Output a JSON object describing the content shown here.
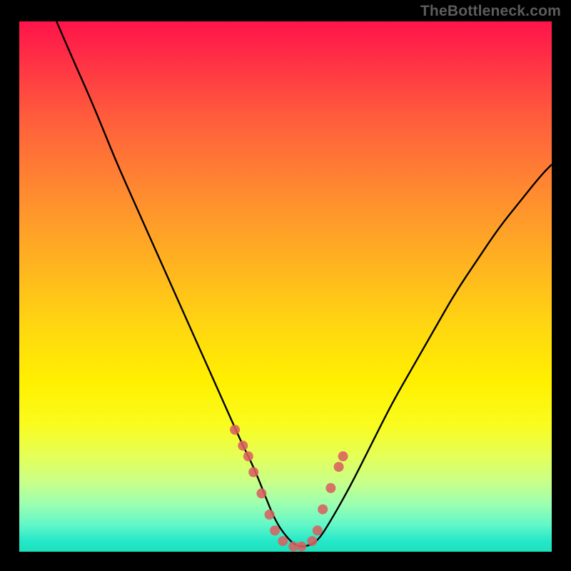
{
  "watermark": "TheBottleneck.com",
  "colors": {
    "frame_bg": "#000000",
    "curve_stroke": "#000000",
    "dot_fill": "#d9605f",
    "gradient_top": "#ff144a",
    "gradient_bottom": "#1ee0bc"
  },
  "chart_data": {
    "type": "line",
    "title": "",
    "xlabel": "",
    "ylabel": "",
    "xlim": [
      0,
      100
    ],
    "ylim": [
      0,
      100
    ],
    "grid": false,
    "series": [
      {
        "name": "curve",
        "x": [
          7,
          10,
          14,
          18,
          22,
          26,
          30,
          34,
          38,
          42,
          44,
          46,
          48,
          50,
          52,
          54,
          56,
          58,
          62,
          66,
          70,
          74,
          78,
          82,
          86,
          90,
          94,
          98,
          100
        ],
        "values": [
          100,
          93,
          84,
          74,
          65,
          56,
          47,
          38,
          29,
          20,
          16,
          11,
          6,
          3,
          1,
          1,
          2,
          5,
          12,
          20,
          28,
          35,
          42,
          49,
          55,
          61,
          66,
          71,
          73
        ]
      },
      {
        "name": "dots",
        "x": [
          40.5,
          42.0,
          43.0,
          44.0,
          45.5,
          47.0,
          48.0,
          49.5,
          51.5,
          53.0,
          55.0,
          56.0,
          57.0,
          58.5,
          60.0,
          60.8
        ],
        "values": [
          23.0,
          20.0,
          18.0,
          15.0,
          11.0,
          7.0,
          4.0,
          2.0,
          1.0,
          1.0,
          2.0,
          4.0,
          8.0,
          12.0,
          16.0,
          18.0
        ]
      }
    ]
  }
}
